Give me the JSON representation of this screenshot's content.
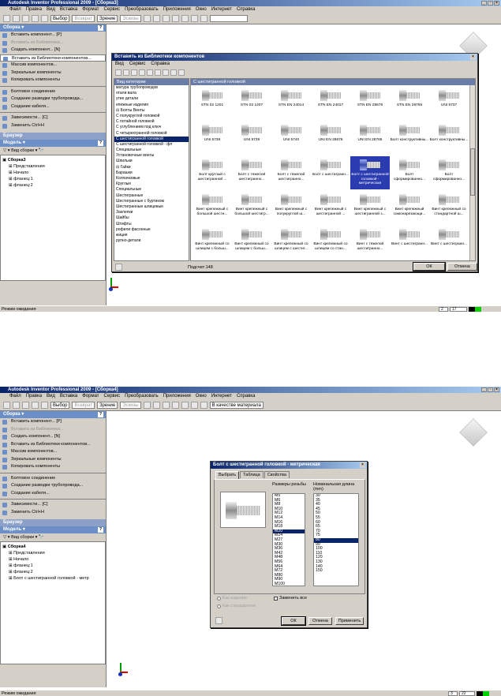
{
  "shot1": {
    "title": "Autodesk Inventor Professional 2009 - [Сборка3]",
    "menu": [
      "Файл",
      "Правка",
      "Вид",
      "Вставка",
      "Формат",
      "Сервис",
      "Преобразовать",
      "Приложения",
      "Окно",
      "Интернет",
      "Справка"
    ],
    "toolbar": {
      "select_label": "Выбор",
      "return_label": "Возврат",
      "zoom_label": "Зрение",
      "sketch_label": "Эскизы"
    },
    "panel_title": "Сборка",
    "panel_items": [
      {
        "label": "Вставить компонент... [P]",
        "state": ""
      },
      {
        "label": "Вставить из Библиотеки...",
        "state": "dis"
      },
      {
        "label": "Создать компонент... [N]",
        "state": ""
      },
      {
        "label": "Вставить из Библиотеки компонентов...",
        "state": "sel"
      },
      {
        "label": "Массив компонентов...",
        "state": ""
      },
      {
        "label": "Зеркальные компоненты",
        "state": ""
      },
      {
        "label": "Копировать компоненты",
        "state": ""
      },
      {
        "label": "Болтовое соединение",
        "state": ""
      },
      {
        "label": "Создание разводки трубопровода...",
        "state": ""
      },
      {
        "label": "Создание кабеля...",
        "state": ""
      },
      {
        "label": "Зависимости... [C]",
        "state": ""
      },
      {
        "label": "Заменить Ctrl+H",
        "state": ""
      }
    ],
    "browser_label": "Браузер",
    "model_label": "Модель",
    "view_label": "Вид сборки",
    "tree": [
      "Сборка3",
      "Представления",
      "Начало",
      "фланец:1",
      "фланец:2"
    ],
    "status": "Режим ожидания",
    "status_num1": "2",
    "status_num2": "17",
    "dialog": {
      "title": "Вставить из Библиотеки компонентов",
      "menu": [
        "Вид",
        "Сервис",
        "Справка"
      ],
      "cat_header": "Вид категории",
      "grid_header": "С шестигранной головкой",
      "categories": [
        {
          "label": "матура трубопроводов",
          "sel": false
        },
        {
          "label": "отали вала",
          "sel": false
        },
        {
          "label": "утие детали",
          "sel": false
        },
        {
          "label": "епежные изделия",
          "sel": false
        },
        {
          "label": "⊟ Болты Винты",
          "sel": false
        },
        {
          "label": "С полукруглой головкой",
          "sel": false
        },
        {
          "label": "С потайной головкой",
          "sel": false
        },
        {
          "label": "С углублением под ключ",
          "sel": false
        },
        {
          "label": "С четырехгранной головкой",
          "sel": false
        },
        {
          "label": "С шестигранной головкой",
          "sel": true
        },
        {
          "label": "С шестигранной головкой - фл",
          "sel": false
        },
        {
          "label": "Специальные",
          "sel": false
        },
        {
          "label": "Установочные винты",
          "sel": false
        },
        {
          "label": "Шпильки",
          "sel": false
        },
        {
          "label": "⊟ Гайки",
          "sel": false
        },
        {
          "label": "Барашки",
          "sel": false
        },
        {
          "label": "Колпачковые",
          "sel": false
        },
        {
          "label": "Круглые",
          "sel": false
        },
        {
          "label": "Специальные",
          "sel": false
        },
        {
          "label": "Шестигранные",
          "sel": false
        },
        {
          "label": "Шестигранные с буртиком",
          "sel": false
        },
        {
          "label": "Шестигранные шлицевые",
          "sel": false
        },
        {
          "label": "Заклепки",
          "sel": false
        },
        {
          "label": "Шайбы",
          "sel": false
        },
        {
          "label": "Штифты",
          "sel": false
        },
        {
          "label": "рофили фасонные",
          "sel": false
        },
        {
          "label": "жиция",
          "sel": false
        },
        {
          "label": "рупно-детали",
          "sel": false
        }
      ],
      "items": [
        {
          "label": "STN 02 1201"
        },
        {
          "label": "STN 02 1207"
        },
        {
          "label": "STN EN 24014"
        },
        {
          "label": "STN EN 24017"
        },
        {
          "label": "STN EN 28676"
        },
        {
          "label": "STN EN 28765"
        },
        {
          "label": "UNI 5737"
        },
        {
          "label": "UNI 5738"
        },
        {
          "label": "UNI 5739"
        },
        {
          "label": "UNI 5740"
        },
        {
          "label": "UNI EN 28676"
        },
        {
          "label": "UNI EN 28765"
        },
        {
          "label": "Болт конструктивны..."
        },
        {
          "label": "Болт конструктивны..."
        },
        {
          "label": "Болт круглый с шестигранной ..."
        },
        {
          "label": "Болт с тяжелой шестигранно..."
        },
        {
          "label": "Болт с тяжелой шестигранно..."
        },
        {
          "label": "Болт с шестигранн..."
        },
        {
          "label": "Болт с шестигранной головкой - метрическая"
        },
        {
          "label": "Болт сформированно..."
        },
        {
          "label": "Болт сформированно..."
        },
        {
          "label": "Винт крепежный с большой шести..."
        },
        {
          "label": "Винт крепежный с большой шестигр..."
        },
        {
          "label": "Винт крепежный с полукруглой ш..."
        },
        {
          "label": "Винт крепежный с шестигранной ..."
        },
        {
          "label": "Винт крепежный с шестигранной з..."
        },
        {
          "label": "Винт крепежный самонарезающи..."
        },
        {
          "label": "Винт крепежный со стандартной ш..."
        },
        {
          "label": "Винт крепежный со шлицем с больш..."
        },
        {
          "label": "Винт крепежный со шлицем с больш..."
        },
        {
          "label": "Винт крепежный со шлицем с шестиг..."
        },
        {
          "label": "Винт крепежный со шлицем со стан..."
        },
        {
          "label": "Винт с тяжелой шестигранно..."
        },
        {
          "label": "Винт с шестигранн..."
        },
        {
          "label": "Винт с шестигранн..."
        }
      ],
      "count": "Подсчет:148",
      "ok": "ОК",
      "cancel": "Отмена"
    }
  },
  "shot2": {
    "title": "Autodesk Inventor Professional 2009 - [Сборка4]",
    "menu": [
      "Файл",
      "Правка",
      "Вид",
      "Вставка",
      "Формат",
      "Сервис",
      "Преобразовать",
      "Приложения",
      "Окно",
      "Интернет",
      "Справка"
    ],
    "toolbar": {
      "select_label": "Выбор",
      "return_label": "Возврат",
      "zoom_label": "Зрение",
      "sketch_label": "Эскизы",
      "material": "В качестве материала"
    },
    "panel_title": "Сборка",
    "panel_items": [
      {
        "label": "Вставить компонент... [P]",
        "state": ""
      },
      {
        "label": "Вставить из Библиотеки...",
        "state": "dis"
      },
      {
        "label": "Создать компонент... [N]",
        "state": ""
      },
      {
        "label": "Вставить из Библиотеки компонентов...",
        "state": ""
      },
      {
        "label": "Массив компонентов...",
        "state": ""
      },
      {
        "label": "Зеркальные компоненты",
        "state": ""
      },
      {
        "label": "Копировать компоненты",
        "state": ""
      },
      {
        "label": "Болтовое соединение",
        "state": ""
      },
      {
        "label": "Создание разводки трубопровода...",
        "state": ""
      },
      {
        "label": "Создание кабеля...",
        "state": ""
      },
      {
        "label": "Зависимости... [C]",
        "state": ""
      },
      {
        "label": "Заменить Ctrl+H",
        "state": ""
      }
    ],
    "browser_label": "Браузер",
    "model_label": "Модель",
    "view_label": "Вид сборки",
    "tree": [
      "Сборка4",
      "Представления",
      "Начало",
      "фланец:1",
      "фланец:2",
      "Болт с шестигранной головкой - метр"
    ],
    "status": "Режим ожидания",
    "status_num1": "3",
    "status_num2": "22",
    "dialog": {
      "title": "Болт с шестигранной головкой - метрическая",
      "tabs": [
        "Выбрать",
        "Таблица",
        "Свойства"
      ],
      "thread_label": "Размеры резьбы",
      "length_label": "Номинальная длина (mm)",
      "threads": [
        {
          "v": "M5",
          "sel": false
        },
        {
          "v": "M6",
          "sel": false
        },
        {
          "v": "M8",
          "sel": false
        },
        {
          "v": "M10",
          "sel": false
        },
        {
          "v": "M12",
          "sel": false
        },
        {
          "v": "M14",
          "sel": false
        },
        {
          "v": "M16",
          "sel": false
        },
        {
          "v": "M18",
          "sel": false
        },
        {
          "v": "M20",
          "sel": true
        },
        {
          "v": "M24",
          "sel": false
        },
        {
          "v": "M27",
          "sel": false
        },
        {
          "v": "M30",
          "sel": false
        },
        {
          "v": "M36",
          "sel": false
        },
        {
          "v": "M42",
          "sel": false
        },
        {
          "v": "M48",
          "sel": false
        },
        {
          "v": "M56",
          "sel": false
        },
        {
          "v": "M64",
          "sel": false
        },
        {
          "v": "M72",
          "sel": false
        },
        {
          "v": "M80",
          "sel": false
        },
        {
          "v": "M90",
          "sel": false
        },
        {
          "v": "M100",
          "sel": false
        }
      ],
      "lengths": [
        {
          "v": "30",
          "sel": false
        },
        {
          "v": "35",
          "sel": false
        },
        {
          "v": "40",
          "sel": false
        },
        {
          "v": "45",
          "sel": false
        },
        {
          "v": "50",
          "sel": false
        },
        {
          "v": "55",
          "sel": false
        },
        {
          "v": "60",
          "sel": false
        },
        {
          "v": "65",
          "sel": false
        },
        {
          "v": "70",
          "sel": false
        },
        {
          "v": "75",
          "sel": false
        },
        {
          "v": "80",
          "sel": true
        },
        {
          "v": "90",
          "sel": false
        },
        {
          "v": "100",
          "sel": false
        },
        {
          "v": "110",
          "sel": false
        },
        {
          "v": "120",
          "sel": false
        },
        {
          "v": "130",
          "sel": false
        },
        {
          "v": "140",
          "sel": false
        },
        {
          "v": "150",
          "sel": false
        }
      ],
      "custom1": "Как изделие",
      "custom2": "Как стандартное",
      "replace_all": "Заменить все",
      "ok": "ОК",
      "cancel": "Отмена",
      "apply": "Применить"
    }
  }
}
